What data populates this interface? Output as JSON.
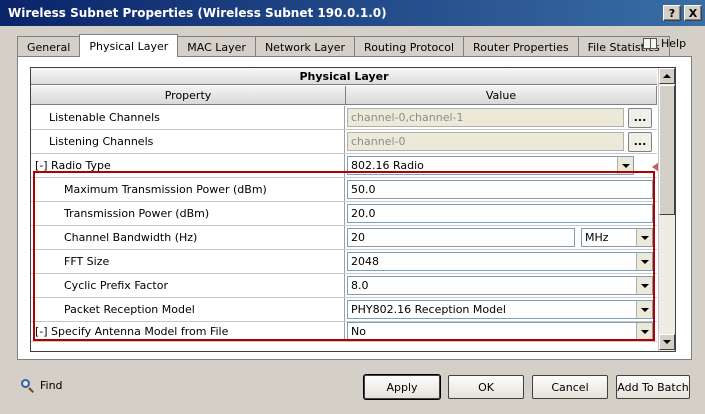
{
  "window": {
    "title": "Wireless Subnet Properties (Wireless Subnet 190.0.1.0)",
    "help_btn": "?",
    "close_btn": "X"
  },
  "tabs": [
    {
      "label": "General"
    },
    {
      "label": "Physical Layer"
    },
    {
      "label": "MAC Layer"
    },
    {
      "label": "Network Layer"
    },
    {
      "label": "Routing Protocol"
    },
    {
      "label": "Router Properties"
    },
    {
      "label": "File Statistics"
    }
  ],
  "help_label": "Help",
  "grid": {
    "title": "Physical Layer",
    "col_property": "Property",
    "col_value": "Value",
    "rows": [
      {
        "prop": "Listenable Channels",
        "value": "channel-0,channel-1",
        "btn": "..."
      },
      {
        "prop": "Listening Channels",
        "value": "channel-0",
        "btn": "..."
      },
      {
        "prop": "[-] Radio Type",
        "value": "802.16 Radio"
      },
      {
        "prop": "Maximum Transmission Power (dBm)",
        "value": "50.0"
      },
      {
        "prop": "Transmission Power (dBm)",
        "value": "20.0"
      },
      {
        "prop": "Channel Bandwidth (Hz)",
        "value": "20",
        "unit": "MHz"
      },
      {
        "prop": "FFT Size",
        "value": "2048"
      },
      {
        "prop": "Cyclic Prefix Factor",
        "value": "8.0"
      },
      {
        "prop": "Packet Reception Model",
        "value": "PHY802.16 Reception Model"
      },
      {
        "prop": "[-] Specify Antenna Model from File",
        "value": "No"
      }
    ]
  },
  "footer": {
    "find": "Find",
    "apply": "Apply",
    "ok": "OK",
    "cancel": "Cancel",
    "add_to_batch": "Add To Batch"
  },
  "colors": {
    "highlight": "#b00000",
    "title_bar": "#0a246a"
  }
}
